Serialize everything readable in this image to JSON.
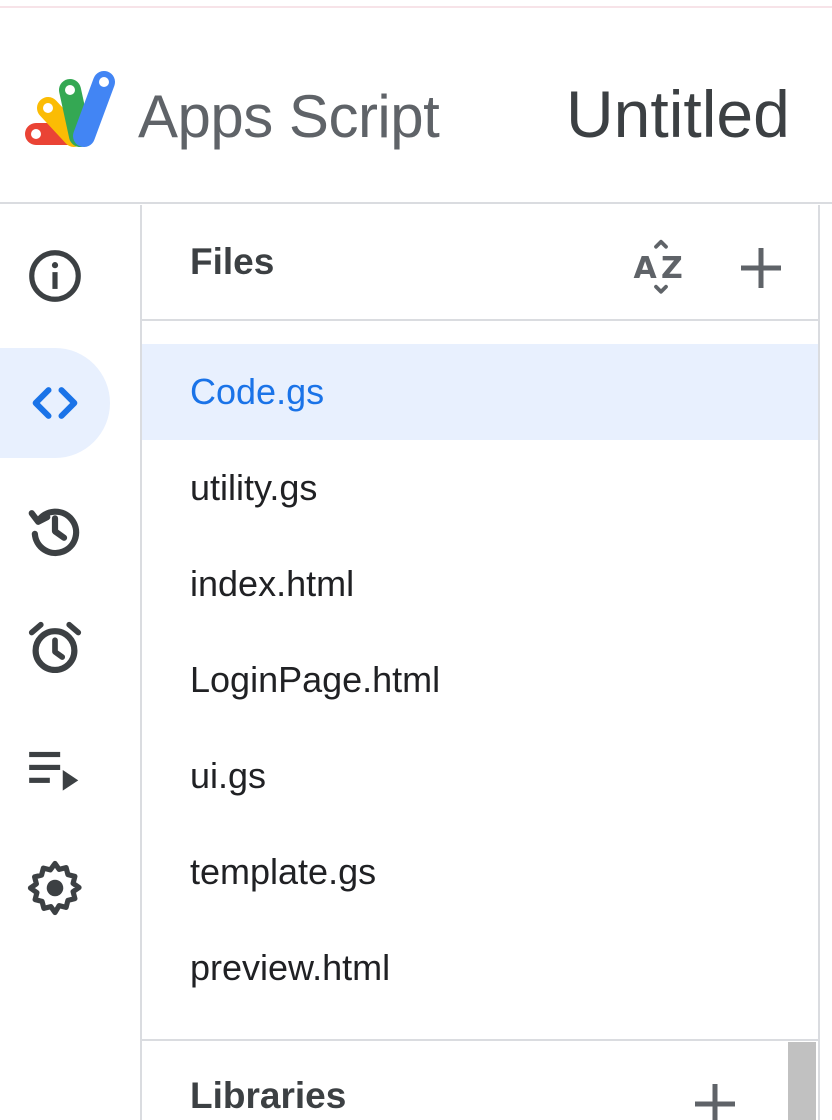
{
  "header": {
    "app_name": "Apps Script",
    "project_title": "Untitled"
  },
  "rail": {
    "items": [
      {
        "name": "overview",
        "icon": "info-icon",
        "active": false
      },
      {
        "name": "editor",
        "icon": "code-icon",
        "active": true
      },
      {
        "name": "project-history",
        "icon": "history-icon",
        "active": false
      },
      {
        "name": "triggers",
        "icon": "alarm-clock-icon",
        "active": false
      },
      {
        "name": "executions",
        "icon": "executions-icon",
        "active": false
      },
      {
        "name": "project-settings",
        "icon": "gear-icon",
        "active": false
      }
    ]
  },
  "files": {
    "title": "Files",
    "sort_icon": "sort-az-icon",
    "add_icon": "plus-icon",
    "items": [
      {
        "label": "Code.gs",
        "selected": true
      },
      {
        "label": "utility.gs",
        "selected": false
      },
      {
        "label": "index.html",
        "selected": false
      },
      {
        "label": "LoginPage.html",
        "selected": false
      },
      {
        "label": "ui.gs",
        "selected": false
      },
      {
        "label": "template.gs",
        "selected": false
      },
      {
        "label": "preview.html",
        "selected": false
      }
    ]
  },
  "libraries": {
    "title": "Libraries",
    "add_icon": "plus-icon"
  },
  "colors": {
    "accent": "#1a73e8",
    "selected_bg": "#e8f0fe",
    "divider": "#dadce0",
    "icon": "#5f6368"
  }
}
